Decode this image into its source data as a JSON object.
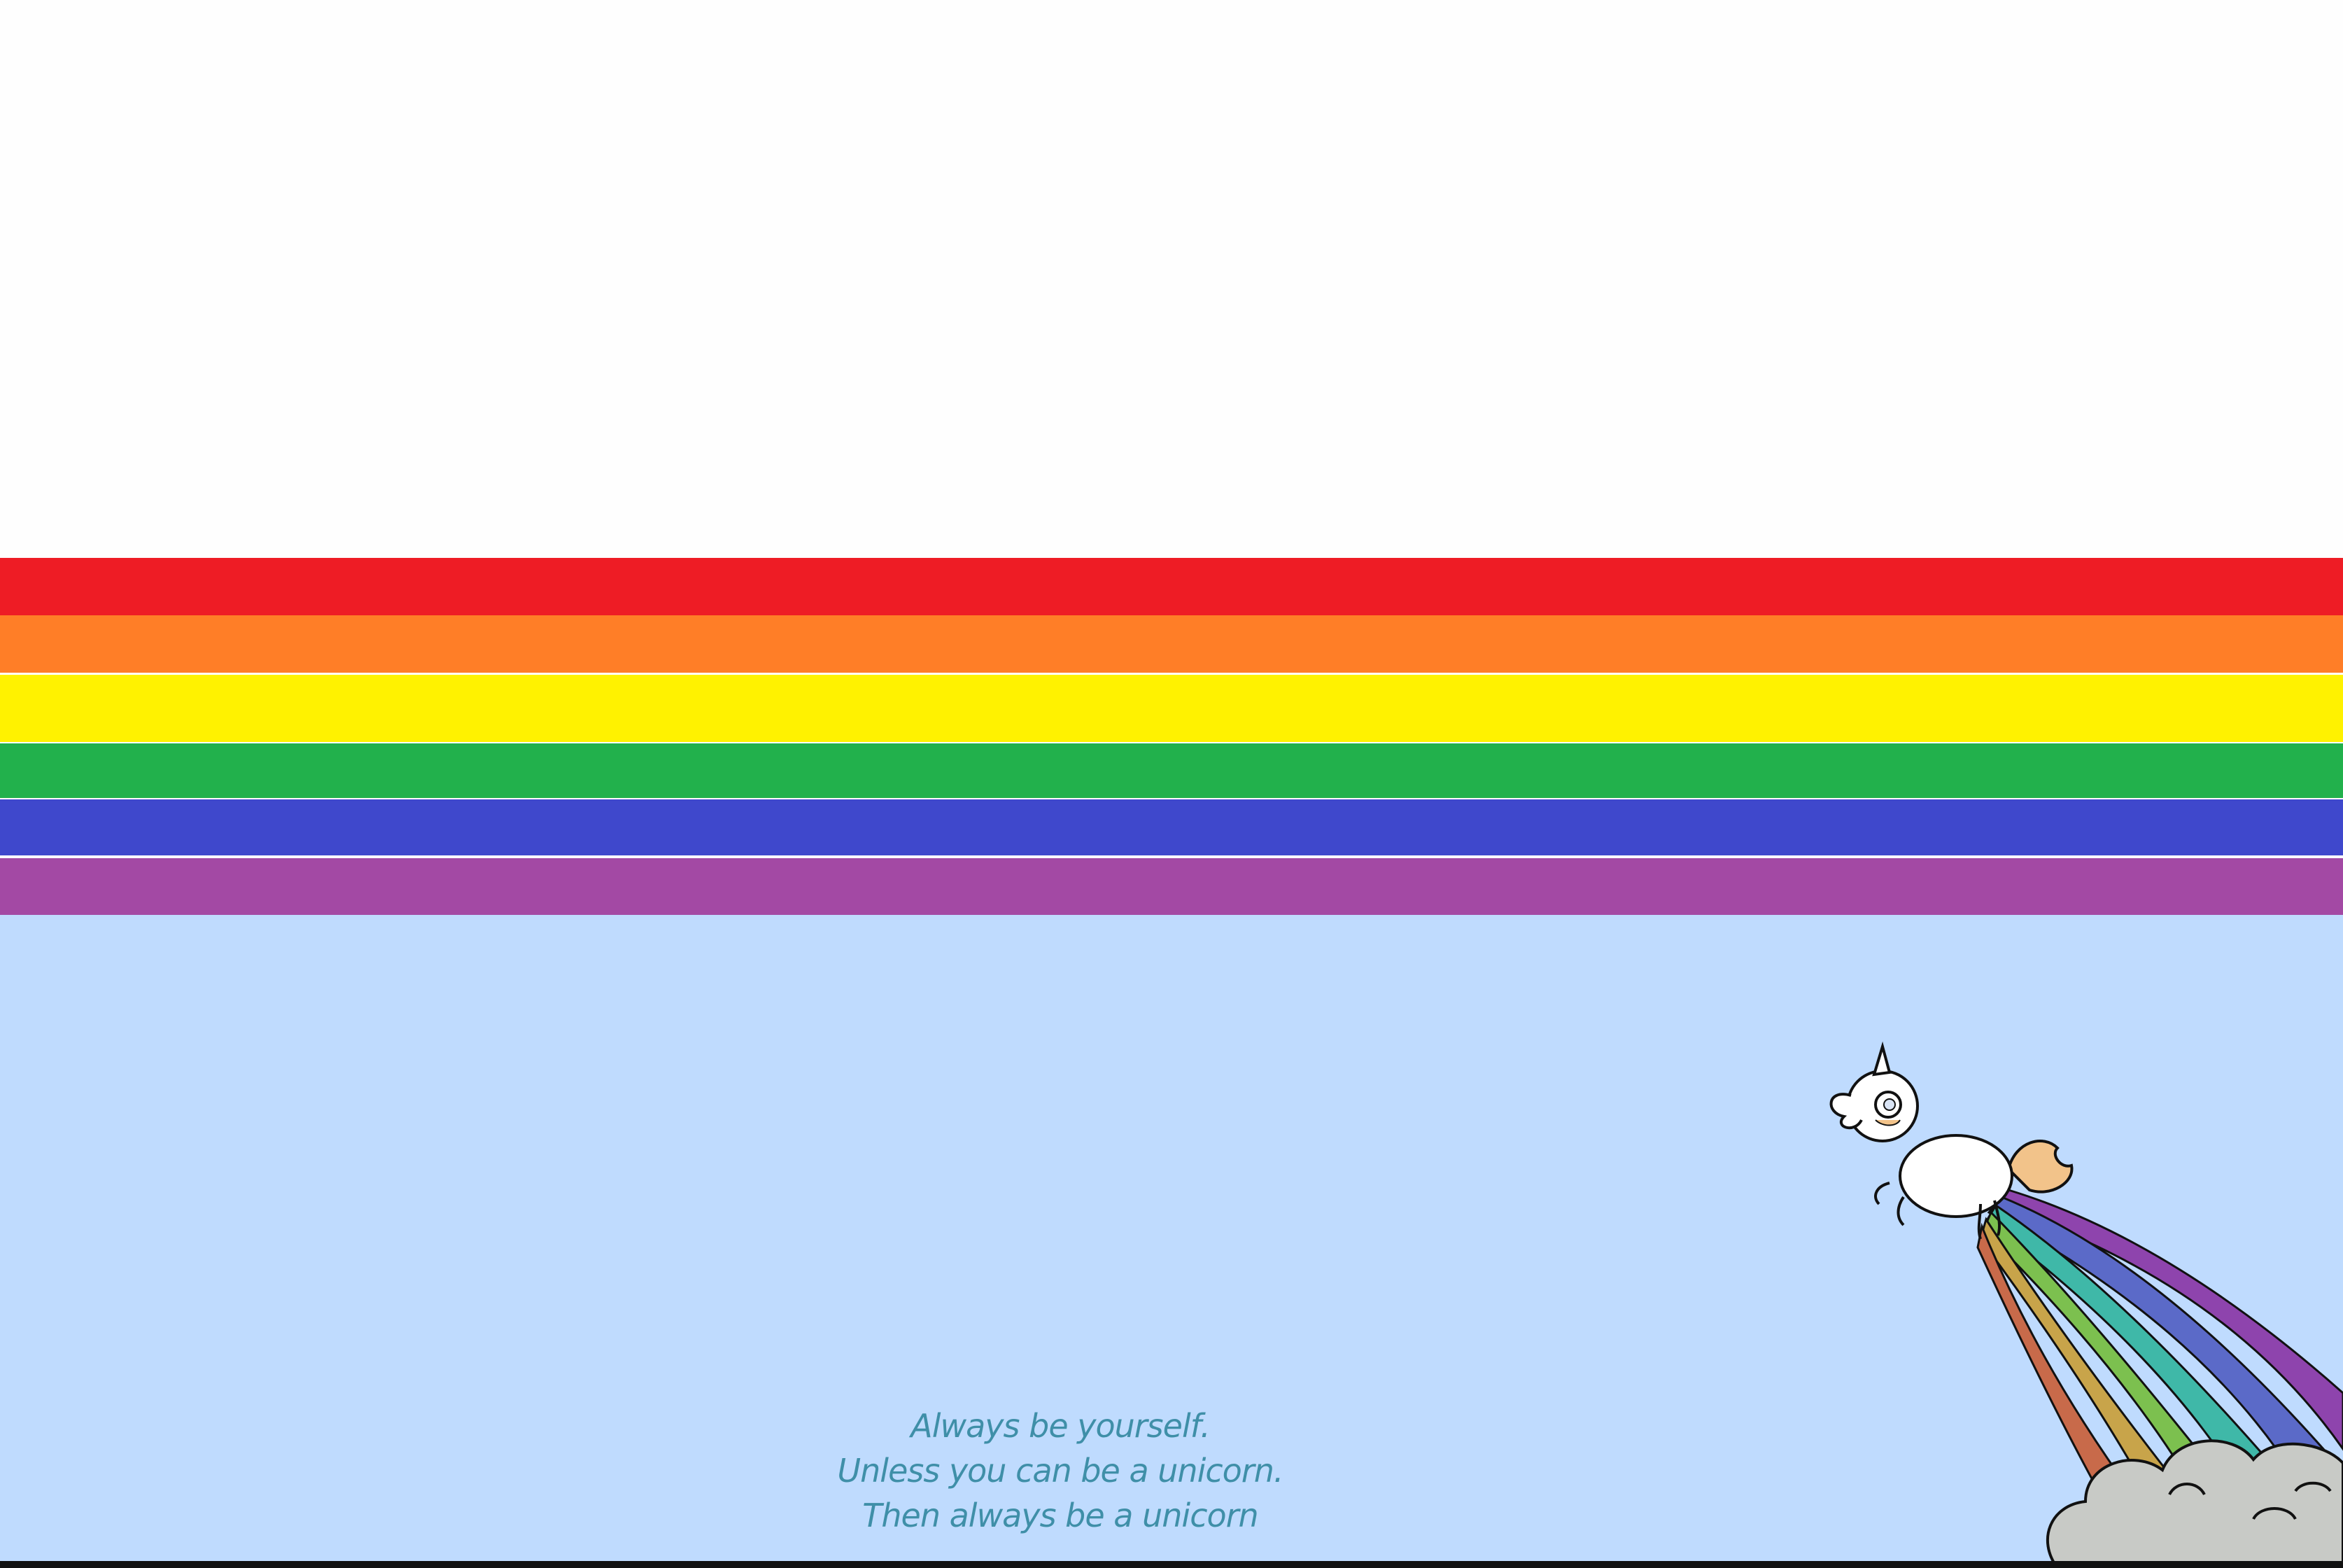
{
  "wallpaper": {
    "top_color": "#fefefe",
    "sky_color": "#bfdbfe",
    "stripes": [
      {
        "name": "red",
        "color": "#ee1c25"
      },
      {
        "name": "orange",
        "color": "#ff7e27"
      },
      {
        "name": "yellow",
        "color": "#fff200"
      },
      {
        "name": "green",
        "color": "#22b14c"
      },
      {
        "name": "blue",
        "color": "#3f48cc"
      },
      {
        "name": "purple",
        "color": "#a349a4"
      }
    ],
    "quote": {
      "line1": "Always be yourself.",
      "line2": "Unless you can be a unicorn.",
      "line3": "Then always be a unicorn",
      "color": "#3f8fa8"
    },
    "icons": [
      "unicorn-icon",
      "rainbow-trail-icon",
      "cloud-icon"
    ]
  }
}
